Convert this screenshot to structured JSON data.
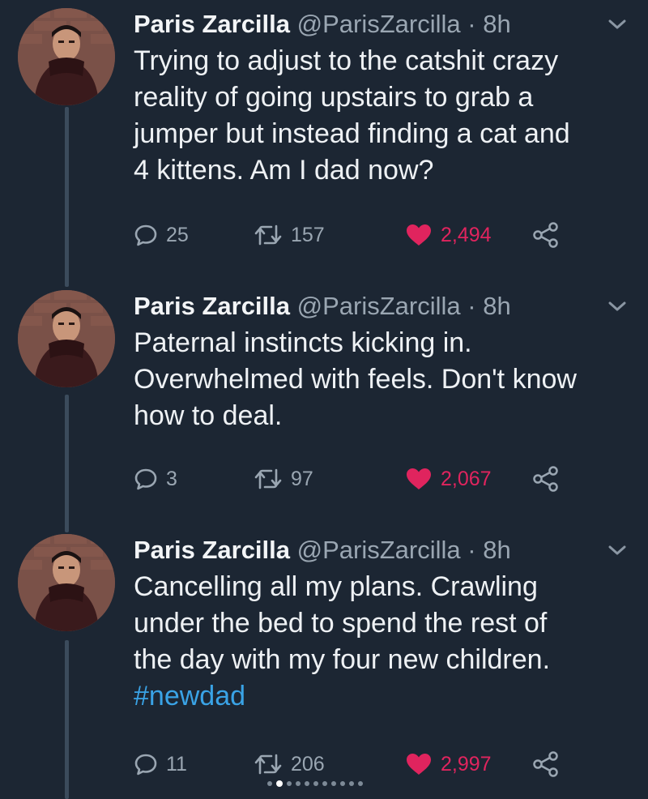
{
  "tweets": [
    {
      "name": "Paris Zarcilla",
      "handle": "@ParisZarcilla",
      "separator": "·",
      "time": "8h",
      "text_lines": [
        "Trying to adjust to the catshit crazy",
        "reality of going upstairs to grab a",
        "jumper but instead finding a cat and",
        "4 kittens. Am I dad now?"
      ],
      "hashtag": "",
      "replies": "25",
      "retweets": "157",
      "likes": "2,494"
    },
    {
      "name": "Paris Zarcilla",
      "handle": "@ParisZarcilla",
      "separator": "·",
      "time": "8h",
      "text_lines": [
        "Paternal instincts kicking in.",
        "Overwhelmed with feels. Don't know",
        "how to deal."
      ],
      "hashtag": "",
      "replies": "3",
      "retweets": "97",
      "likes": "2,067"
    },
    {
      "name": "Paris Zarcilla",
      "handle": "@ParisZarcilla",
      "separator": "·",
      "time": "8h",
      "text_lines": [
        "Cancelling all my plans. Crawling",
        "under the bed to spend the rest of",
        "the day with my four new children."
      ],
      "hashtag": "#newdad",
      "replies": "11",
      "retweets": "206",
      "likes": "2,997"
    }
  ],
  "icons": {
    "reply": "reply-icon",
    "retweet": "retweet-icon",
    "like": "heart-icon",
    "share": "share-icon",
    "caret": "chevron-down-icon"
  },
  "colors": {
    "background": "#1c2633",
    "like": "#e0245e",
    "hashtag": "#3aa3e6",
    "muted": "#9aa6b2"
  }
}
